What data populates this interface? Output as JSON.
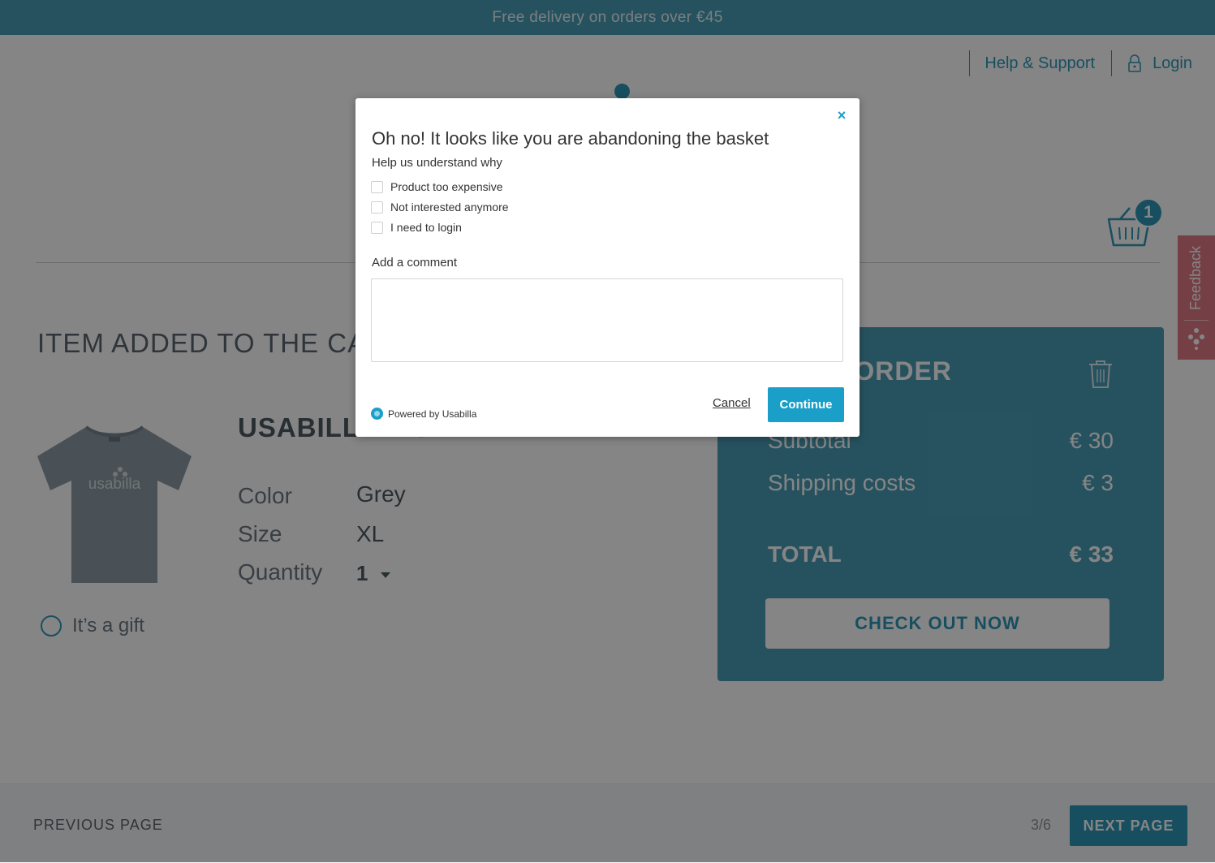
{
  "promo": {
    "text": "Free delivery on orders over €45"
  },
  "nav": {
    "help": "Help & Support",
    "login": "Login"
  },
  "cart": {
    "count": "1"
  },
  "section": {
    "title": "ITEM ADDED TO THE CART"
  },
  "product": {
    "name": "USABILLA T-SHIRT",
    "image_text": "usabilla",
    "attributes": [
      {
        "label": "Color",
        "value": "Grey"
      },
      {
        "label": "Size",
        "value": "XL"
      },
      {
        "label": "Quantity",
        "value": "1"
      }
    ],
    "gift_label": "It’s a gift"
  },
  "order": {
    "title": "YOUR ORDER",
    "subtotal_label": "Subtotal",
    "subtotal_value": "€ 30",
    "shipping_label": "Shipping costs",
    "shipping_value": "€ 3",
    "total_label": "TOTAL",
    "total_value": "€ 33",
    "checkout_label": "CHECK OUT NOW"
  },
  "footer": {
    "prev": "PREVIOUS PAGE",
    "page": "3/6",
    "next": "NEXT PAGE"
  },
  "feedback_tab": {
    "label": "Feedback"
  },
  "modal": {
    "close": "×",
    "title": "Oh no! It looks like you are abandoning the basket",
    "subtitle": "Help us understand why",
    "options": [
      "Product too expensive",
      "Not interested anymore",
      "I need to login"
    ],
    "comment_label": "Add a comment",
    "powered_by": "Powered by Usabilla",
    "cancel": "Cancel",
    "continue": "Continue"
  },
  "colors": {
    "brand": "#2f97b8",
    "feedback": "#e07a86",
    "modal_accent": "#1a9fc9"
  }
}
